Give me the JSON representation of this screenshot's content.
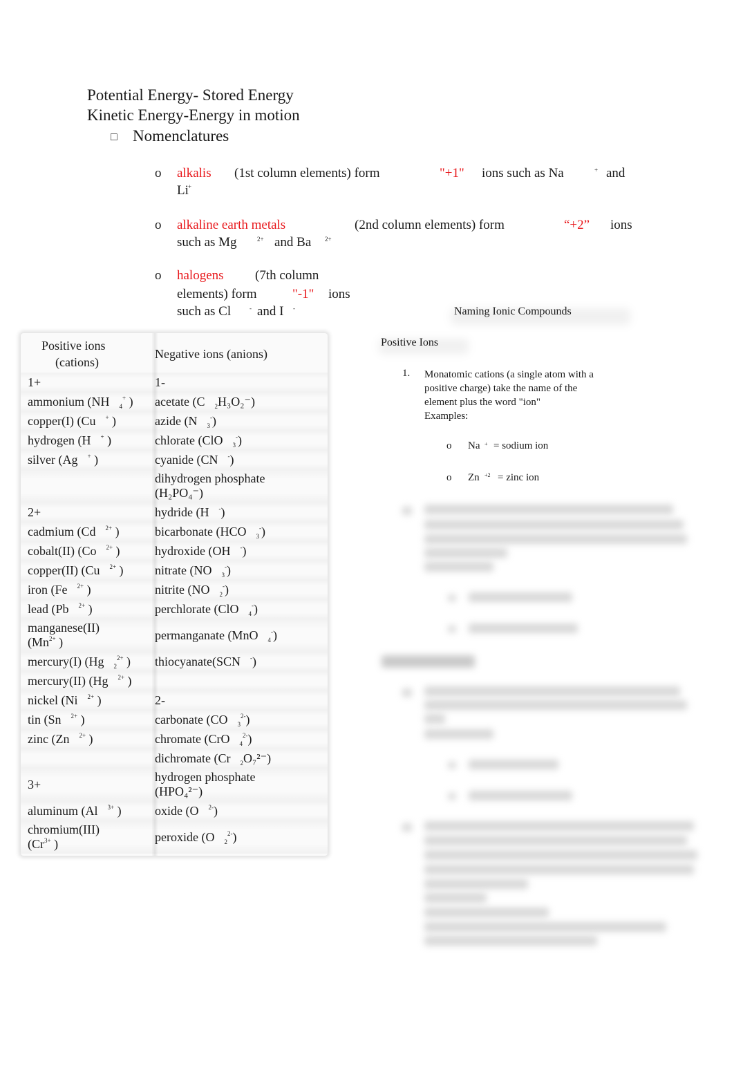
{
  "header": {
    "line1": "Potential Energy- Stored Energy",
    "line2": "Kinetic Energy-Energy in motion",
    "bullet_icon": "□",
    "section": "Nomenclatures"
  },
  "groups": [
    {
      "bullet": "o",
      "term": "alkalis",
      "desc": "(1st column elements) form",
      "charge": "\"+1\"",
      "rest1": "ions such as Na",
      "sup1": "+",
      "rest2": "and",
      "line2": "Li",
      "line2_sup": "+"
    },
    {
      "bullet": "o",
      "term": "alkaline earth metals",
      "desc": "(2nd column elements) form",
      "charge": "“+2”",
      "rest1": "ions",
      "line2a": "such as Mg",
      "sup1": "2+",
      "line2b": "and Ba",
      "sup2": "2+"
    },
    {
      "bullet": "o",
      "term": "halogens",
      "desc": "(7th column",
      "line2": "elements) form",
      "charge": "\"-1\"",
      "line2b": "ions",
      "line3a": "such as Cl",
      "sup1": "-",
      "line3b": "and I",
      "sup2": "-"
    }
  ],
  "table": {
    "headers": {
      "left_1": "Positive ions",
      "left_2": "(cations)",
      "right": "Negative ions (anions)"
    },
    "rows": [
      {
        "l": "1+",
        "r": "1-"
      },
      {
        "l": "ammonium (NH",
        "l_sub": "4",
        "l_sup": "+",
        "r": "acetate (C",
        "r_rest": "H₃O₂⁻)"
      },
      {
        "l": "copper(I) (Cu",
        "l_sup": "+",
        "r": "azide (N",
        "r_sub": "3",
        "r_sup": "-"
      },
      {
        "l": "hydrogen (H",
        "l_sup": "+",
        "r": "chlorate (ClO",
        "r_sub": "3",
        "r_sup": "-"
      },
      {
        "l": "silver (Ag",
        "l_sup": "+",
        "r": "cyanide (CN",
        "r_sup": "-"
      },
      {
        "l": "",
        "r": "dihydrogen phosphate",
        "r2": "(H₂PO₄⁻)"
      },
      {
        "l": "2+",
        "r": "hydride (H",
        "r_sup": "-"
      },
      {
        "l": "cadmium (Cd",
        "l_sup": "2+",
        "r": "bicarbonate (HCO",
        "r_sub": "3",
        "r_sup": "-"
      },
      {
        "l": "cobalt(II) (Co",
        "l_sup": "2+",
        "r": "hydroxide (OH",
        "r_sup": "-"
      },
      {
        "l": "copper(II) (Cu",
        "l_sup": "2+",
        "r": "nitrate (NO",
        "r_sub": "3",
        "r_sup": "-"
      },
      {
        "l": "iron (Fe",
        "l_sup": "2+",
        "r": "nitrite (NO",
        "r_sub": "2",
        "r_sup": "-"
      },
      {
        "l": "lead (Pb",
        "l_sup": "2+",
        "r": "perchlorate (ClO",
        "r_sub": "4",
        "r_sup": "-"
      },
      {
        "l": "manganese(II)",
        "l2": "(Mn",
        "l_sup": "2+",
        "r": "permanganate (MnO",
        "r_sub": "4",
        "r_sup": "-"
      },
      {
        "l": "mercury(I) (Hg",
        "l_sub": "2",
        "l_sup": "2+",
        "r": "thiocyanate(SCN",
        "r_sup": "-"
      },
      {
        "l": "mercury(II) (Hg",
        "l_sup": "2+",
        "r": ""
      },
      {
        "l": "nickel (Ni",
        "l_sup": "2+",
        "r": "2-"
      },
      {
        "l": "tin (Sn",
        "l_sup": "2+",
        "r": "carbonate (CO",
        "r_sub": "3",
        "r_sup": "2-"
      },
      {
        "l": "zinc (Zn",
        "l_sup": "2+",
        "r": "chromate (CrO",
        "r_sub": "4",
        "r_sup": "2-"
      },
      {
        "l": "",
        "r": "dichromate (Cr",
        "r_rest": "O₇²⁻)"
      },
      {
        "l": "3+",
        "r": "hydrogen phosphate",
        "r2": "(HPO₄²⁻)"
      },
      {
        "l": "aluminum (Al",
        "l_sup": "3+",
        "r": "oxide (O",
        "r_sup": "2-"
      },
      {
        "l": "chromium(III)",
        "l2": "(Cr",
        "l_sup": "3+",
        "r": "peroxide (O",
        "r_sub": "2",
        "r_sup": "2-"
      }
    ]
  },
  "right_panel": {
    "title": "Naming Ionic Compounds",
    "subtitle": "Positive Ions",
    "item1_num": "1.",
    "item1_lines": [
      "Monatomic cations (a single atom with a",
      "positive charge) take the name of the",
      "element plus the word \"ion\"",
      "Examples:"
    ],
    "examples": [
      {
        "bullet": "o",
        "ion": "Na",
        "sup": "+",
        "text": "= sodium ion"
      },
      {
        "bullet": "o",
        "ion": "Zn",
        "sup": "+2",
        "text": "= zinc ion"
      }
    ]
  }
}
